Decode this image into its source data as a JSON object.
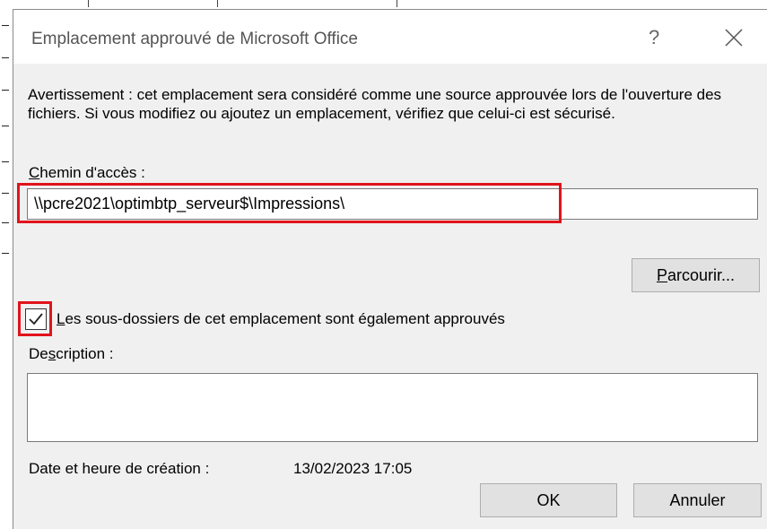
{
  "dialog": {
    "title": "Emplacement approuvé de Microsoft Office",
    "help_glyph": "?",
    "warning": "Avertissement : cet emplacement sera considéré comme une source approuvée lors de l'ouverture des fichiers. Si vous modifiez ou ajoutez un emplacement, vérifiez que celui-ci est sécurisé.",
    "path_label_prefix": "",
    "path_label_underlined": "C",
    "path_label_rest": "hemin d'accès :",
    "path_value": "\\\\pcre2021\\optimbtp_serveur$\\Impressions\\",
    "browse_underlined": "P",
    "browse_rest": "arcourir...",
    "checkbox_checked": true,
    "checkbox_underlined": "L",
    "checkbox_rest": "es sous-dossiers de cet emplacement sont également approuvés",
    "description_prefix": "De",
    "description_underlined": "s",
    "description_rest": "cription :",
    "description_value": "",
    "date_label": "Date et heure de création :",
    "date_value": "13/02/2023 17:05",
    "ok_label": "OK",
    "cancel_label": "Annuler",
    "highlight_color": "#e0141c"
  }
}
